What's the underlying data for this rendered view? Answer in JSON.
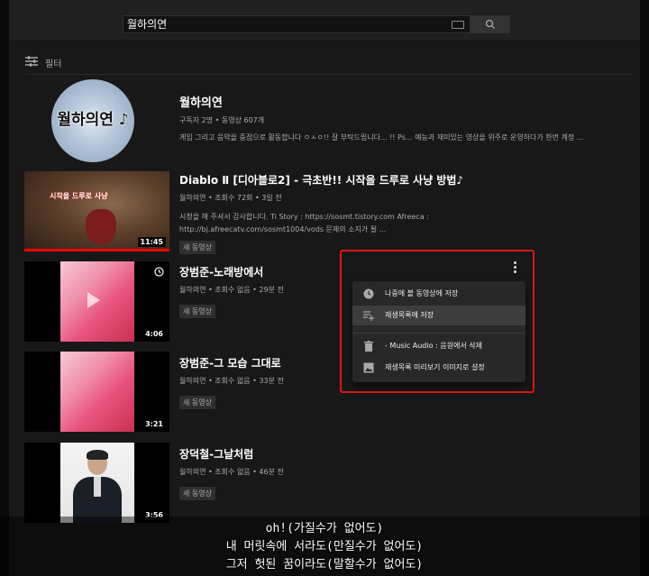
{
  "search": {
    "query": "월하의연"
  },
  "filter": {
    "label": "필터"
  },
  "channel": {
    "name": "월하의연",
    "meta": "구독자 2명 • 동영상 607개",
    "description": "게임 그리고 음악을 중점으로 활동합니다 ㅇㅅㅇ!! 잘 부탁드립니다... !! Ps... 예능과 재미있는 영상을 위주로 운영하다가 한번 계정 ...",
    "avatar_text": "월하의연 ♪"
  },
  "videos": [
    {
      "title": "Diablo Ⅱ [디아블로2] - 극초반!! 시작을 드루로 사냥 방법♪",
      "meta": "월하의연 • 조회수 72회 • 3일 전",
      "desc1": "시청을 해 주셔서 감사합니다. Ti Story : https://sosmt.tistory.com Afreeca :",
      "desc2": "http://bj.afreecatv.com/sosmt1004/vods 문제의 소지가 될 ...",
      "badge": "새 동영상",
      "duration": "11:45",
      "thumb_text": "시작을 드루로 사냥"
    },
    {
      "title": "장범준-노래방에서",
      "meta": "월하의연 • 조회수 없음 • 29분 전",
      "badge": "새 동영상",
      "duration": "4:06"
    },
    {
      "title": "장범준-그 모습 그대로",
      "meta": "월하의연 • 조회수 없음 • 33분 전",
      "badge": "새 동영상",
      "duration": "3:21"
    },
    {
      "title": "장덕철-그날처럼",
      "meta": "월하의연 • 조회수 없음 • 46분 전",
      "badge": "새 동영상",
      "duration": "3:56"
    }
  ],
  "context_menu": {
    "items": [
      {
        "label": "나중에 볼 동영상에 저장",
        "icon": "clock-icon"
      },
      {
        "label": "재생목록에 저장",
        "icon": "playlist-add-icon"
      },
      {
        "label": "- Music Audio : 음원에서 삭제",
        "icon": "trash-icon"
      },
      {
        "label": "재생목록 미리보기 이미지로 설정",
        "icon": "image-icon"
      }
    ]
  },
  "subtitles": {
    "line1": "oh!(가질수가 없어도)",
    "line2": "내 머릿속에 서라도(만질수가 없어도)",
    "line3": "그저 헛된 꿈이라도(말할수가 없어도)"
  }
}
